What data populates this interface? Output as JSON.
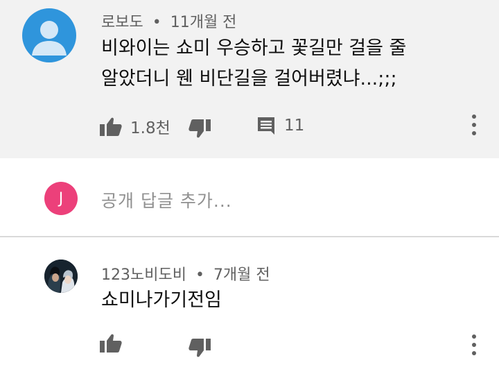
{
  "comment": {
    "author": "로보도",
    "time": "11개월 전",
    "text_line1": "비와이는 쇼미 우승하고 꽃길만 걸을 줄",
    "text_line2": "알았더니 웬 비단길을 걸어버렸냐...;;;",
    "likes": "1.8천",
    "replies": "11"
  },
  "reply_box": {
    "avatar_letter": "J",
    "placeholder": "공개 답글 추가..."
  },
  "reply": {
    "author": "123노비도비",
    "time": "7개월 전",
    "text": "쇼미나가기전임"
  },
  "meta_separator": "•",
  "colors": {
    "highlight_bg": "#f2f2f2",
    "default_avatar": "#2f95dc",
    "user_avatar": "#ec407a",
    "icon": "#606060",
    "secondary_text": "#606060",
    "placeholder_text": "#909090"
  },
  "icons": [
    "person-icon",
    "thumbs-up-icon",
    "thumbs-down-icon",
    "reply-icon",
    "more-vertical-icon"
  ]
}
